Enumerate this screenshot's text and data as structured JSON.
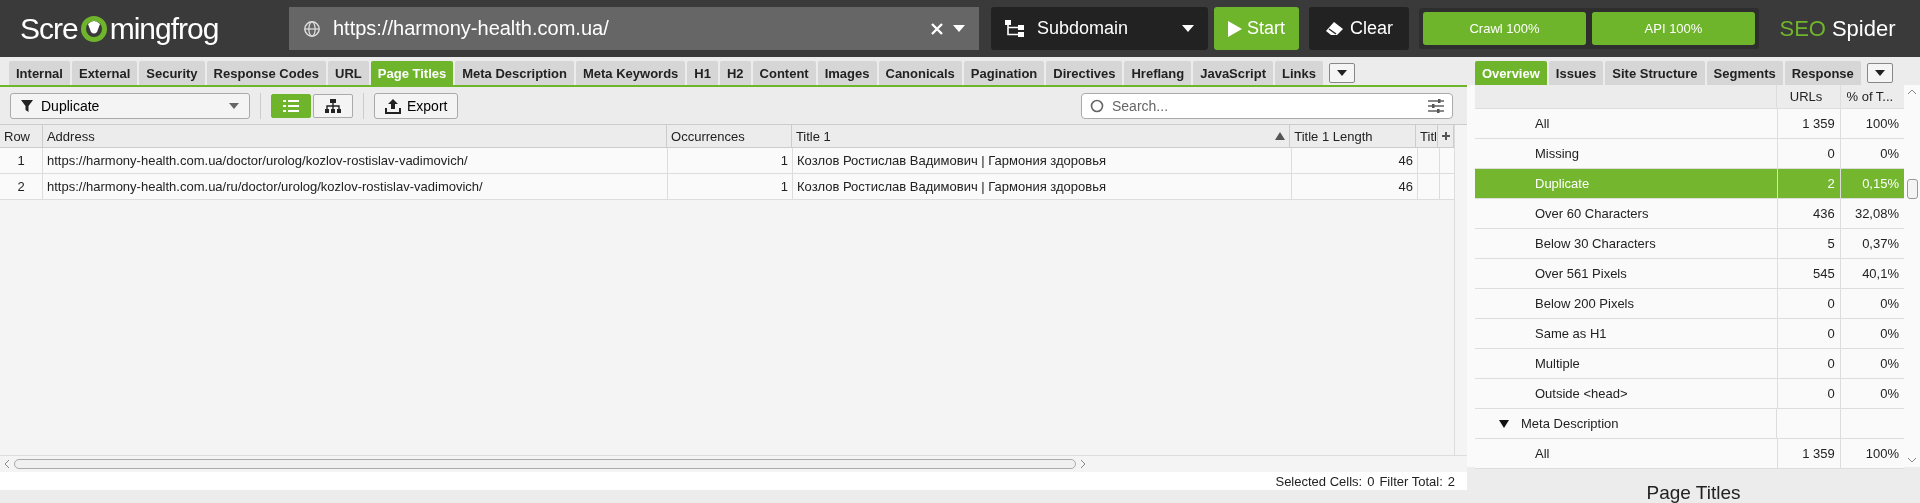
{
  "logo": {
    "text_before": "Scre",
    "text_after": "mingfrog"
  },
  "url_field": {
    "value": "https://harmony-health.com.ua/"
  },
  "mode_dropdown": {
    "value": "Subdomain"
  },
  "start_button": "Start",
  "clear_button": "Clear",
  "progress": [
    {
      "label": "Crawl 100%",
      "level": 1
    },
    {
      "label": "API 100%",
      "level": 1
    }
  ],
  "product": {
    "brand": "SEO",
    "name": "Spider"
  },
  "tabs": [
    {
      "label": "Internal",
      "selected": false
    },
    {
      "label": "External",
      "selected": false
    },
    {
      "label": "Security",
      "selected": false
    },
    {
      "label": "Response Codes",
      "selected": false
    },
    {
      "label": "URL",
      "selected": false
    },
    {
      "label": "Page Titles",
      "selected": true
    },
    {
      "label": "Meta Description",
      "selected": false
    },
    {
      "label": "Meta Keywords",
      "selected": false
    },
    {
      "label": "H1",
      "selected": false
    },
    {
      "label": "H2",
      "selected": false
    },
    {
      "label": "Content",
      "selected": false
    },
    {
      "label": "Images",
      "selected": false
    },
    {
      "label": "Canonicals",
      "selected": false
    },
    {
      "label": "Pagination",
      "selected": false
    },
    {
      "label": "Directives",
      "selected": false
    },
    {
      "label": "Hreflang",
      "selected": false
    },
    {
      "label": "JavaScript",
      "selected": false
    },
    {
      "label": "Links",
      "selected": false
    }
  ],
  "filter": {
    "value": "Duplicate"
  },
  "view_toggle": [
    {
      "kind": "list",
      "selected": true
    },
    {
      "kind": "tree",
      "selected": false
    }
  ],
  "export_button": "Export",
  "search": {
    "placeholder": "Search..."
  },
  "table": {
    "columns": [
      {
        "label": "Row"
      },
      {
        "label": "Address"
      },
      {
        "label": "Occurrences"
      },
      {
        "label": "Title 1",
        "sorted": true
      },
      {
        "label": "Title 1 Length"
      },
      {
        "label": "Titl"
      }
    ],
    "rows": [
      {
        "cells": [
          "1",
          "https://harmony-health.com.ua/doctor/urolog/kozlov-rostislav-vadimovich/",
          "1",
          "Козлов Ростислав Вадимович | Гармония здоровья",
          "46"
        ]
      },
      {
        "cells": [
          "2",
          "https://harmony-health.com.ua/ru/doctor/urolog/kozlov-rostislav-vadimovich/",
          "1",
          "Козлов Ростислав Вадимович | Гармония здоровья",
          "46"
        ]
      }
    ]
  },
  "status_bar": {
    "selected_cells_label": "Selected Cells:",
    "selected_cells": "0",
    "filter_total_label": "Filter Total:",
    "filter_total": "2"
  },
  "right_tabs": [
    {
      "label": "Overview",
      "selected": true
    },
    {
      "label": "Issues",
      "selected": false
    },
    {
      "label": "Site Structure",
      "selected": false
    },
    {
      "label": "Segments",
      "selected": false
    },
    {
      "label": "Response",
      "selected": false
    }
  ],
  "overview": {
    "columns": [
      "URLs",
      "% of T..."
    ],
    "rows": [
      {
        "kind": "item",
        "label": "All",
        "urls": "1 359",
        "percent": "100%",
        "selected": false
      },
      {
        "kind": "item",
        "label": "Missing",
        "urls": "0",
        "percent": "0%",
        "selected": false
      },
      {
        "kind": "item",
        "label": "Duplicate",
        "urls": "2",
        "percent": "0,15%",
        "selected": true
      },
      {
        "kind": "item",
        "label": "Over 60 Characters",
        "urls": "436",
        "percent": "32,08%",
        "selected": false
      },
      {
        "kind": "item",
        "label": "Below 30 Characters",
        "urls": "5",
        "percent": "0,37%",
        "selected": false
      },
      {
        "kind": "item",
        "label": "Over 561 Pixels",
        "urls": "545",
        "percent": "40,1%",
        "selected": false
      },
      {
        "kind": "item",
        "label": "Below 200 Pixels",
        "urls": "0",
        "percent": "0%",
        "selected": false
      },
      {
        "kind": "item",
        "label": "Same as H1",
        "urls": "0",
        "percent": "0%",
        "selected": false
      },
      {
        "kind": "item",
        "label": "Multiple",
        "urls": "0",
        "percent": "0%",
        "selected": false
      },
      {
        "kind": "item",
        "label": "Outside <head>",
        "urls": "0",
        "percent": "0%",
        "selected": false
      },
      {
        "kind": "group",
        "label": "Meta Description",
        "expanded": true
      },
      {
        "kind": "item",
        "label": "All",
        "urls": "1 359",
        "percent": "100%",
        "selected": false
      }
    ]
  },
  "panel_title": "Page Titles"
}
